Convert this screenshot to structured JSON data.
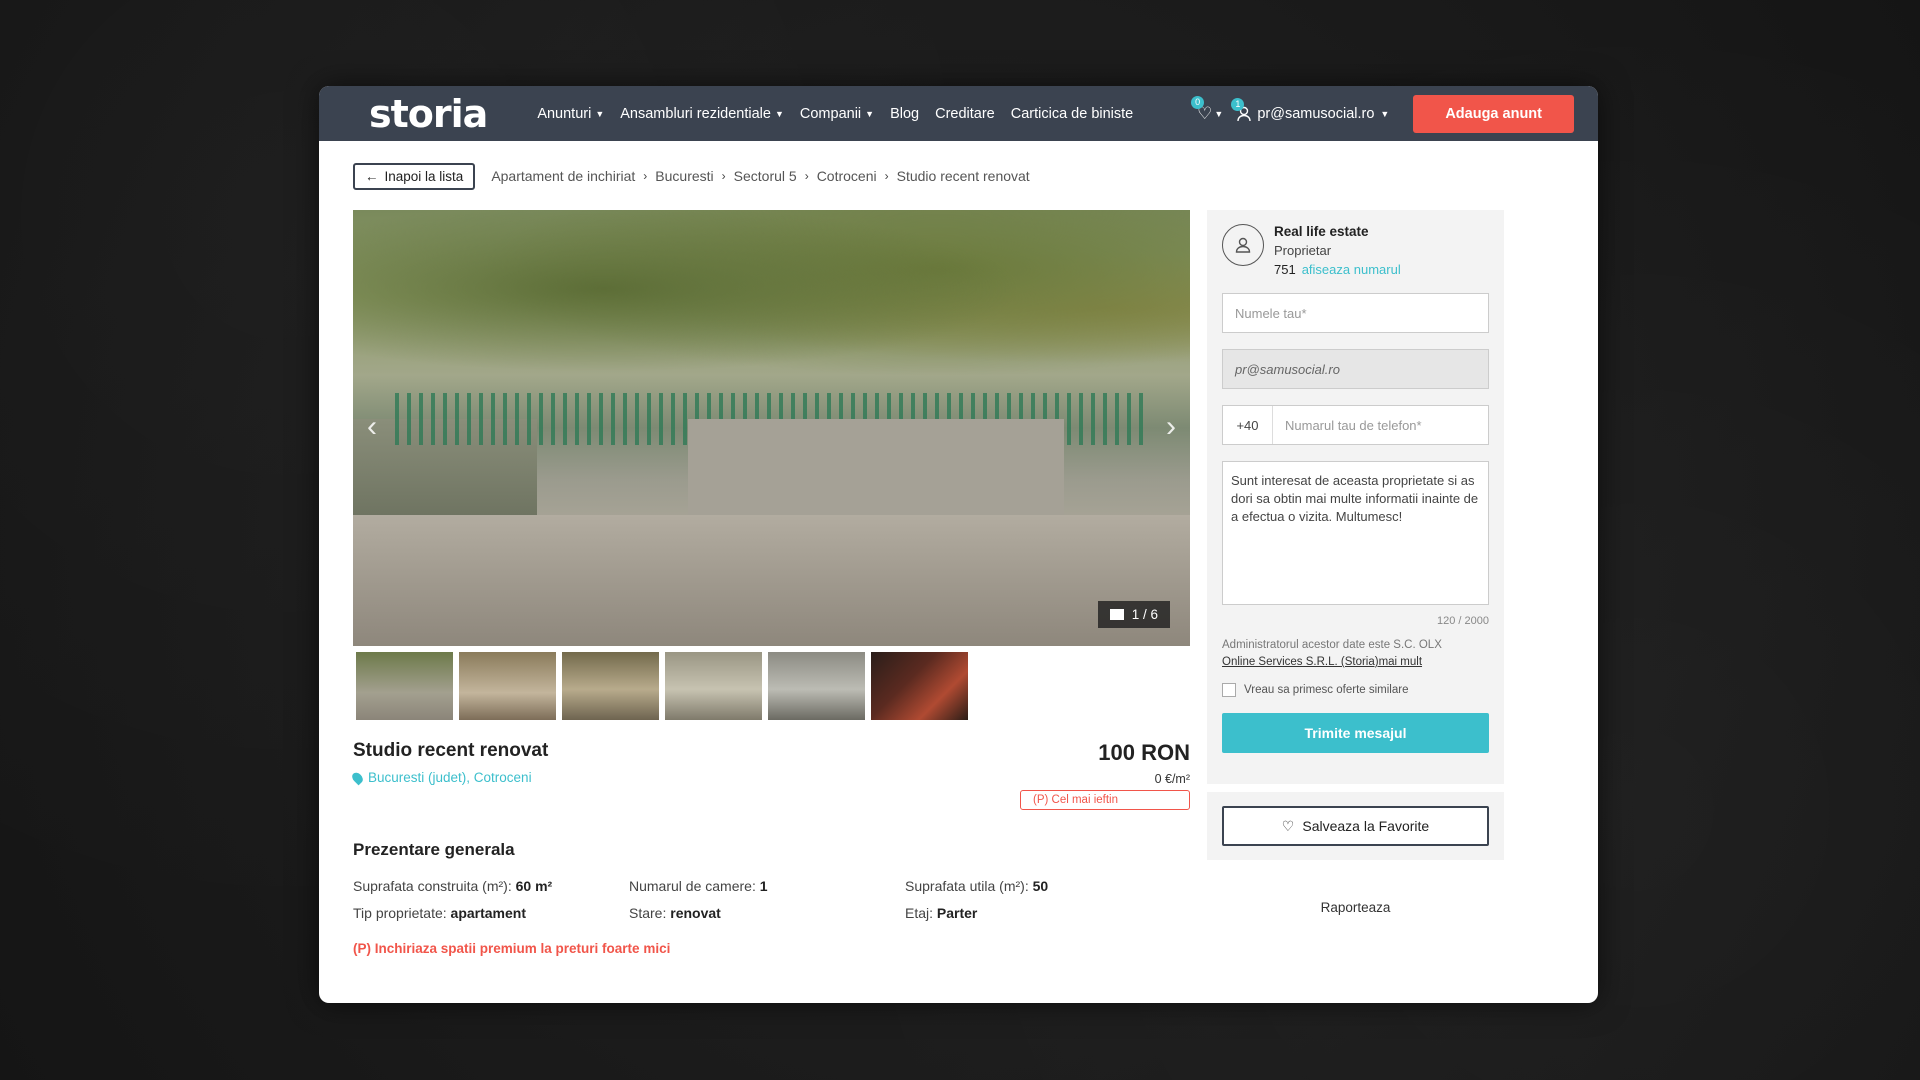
{
  "header": {
    "logo": "storia",
    "nav": [
      "Anunturi",
      "Ansambluri rezidentiale",
      "Companii",
      "Blog",
      "Creditare",
      "Carticica de biniste"
    ],
    "nav_has_caret": [
      true,
      true,
      true,
      false,
      false,
      false
    ],
    "fav_count": "0",
    "user_count": "1",
    "user_email": "pr@samusocial.ro",
    "add_button": "Adauga anunt"
  },
  "breadcrumb": {
    "back": "Inapoi la lista",
    "items": [
      "Apartament de inchiriat",
      "Bucuresti",
      "Sectorul 5",
      "Cotroceni",
      "Studio recent renovat"
    ]
  },
  "gallery": {
    "counter": "1 / 6"
  },
  "listing": {
    "title": "Studio recent renovat",
    "location": "Bucuresti (judet), Cotroceni",
    "price": "100 RON",
    "price_per_m2": "0 €/m²",
    "price_tag": "(P) Cel mai ieftin"
  },
  "overview": {
    "title": "Prezentare generala",
    "specs": [
      {
        "label": "Suprafata construita (m²):",
        "value": "60 m²"
      },
      {
        "label": "Numarul de camere:",
        "value": "1"
      },
      {
        "label": "Suprafata utila (m²):",
        "value": "50"
      },
      {
        "label": "Tip proprietate:",
        "value": "apartament"
      },
      {
        "label": "Stare:",
        "value": "renovat"
      },
      {
        "label": "Etaj:",
        "value": "Parter"
      }
    ],
    "promo": "(P) Inchiriaza spatii premium la preturi foarte mici"
  },
  "contact": {
    "agent_name": "Real life estate",
    "agent_role": "Proprietar",
    "phone_prefix": "751",
    "show_number": "afiseaza numarul",
    "name_placeholder": "Numele tau*",
    "email_value": "pr@samusocial.ro",
    "country_code": "+40",
    "phone_placeholder": "Numarul tau de telefon*",
    "message": "Sunt interesat de aceasta proprietate si as dori sa obtin mai multe informatii inainte de a efectua o vizita. Multumesc!",
    "char_count": "120 / 2000",
    "admin_text": "Administratorul acestor date este S.C. OLX",
    "admin_link": "Online Services S.R.L. (Storia)mai mult",
    "similar_offers": "Vreau sa primesc oferte similare",
    "send": "Trimite mesajul",
    "save_fav": "Salveaza la Favorite",
    "report": "Raporteaza"
  },
  "colors": {
    "nav_bg": "#3b4350",
    "accent": "#3cbfcc",
    "cta": "#f1554a"
  }
}
